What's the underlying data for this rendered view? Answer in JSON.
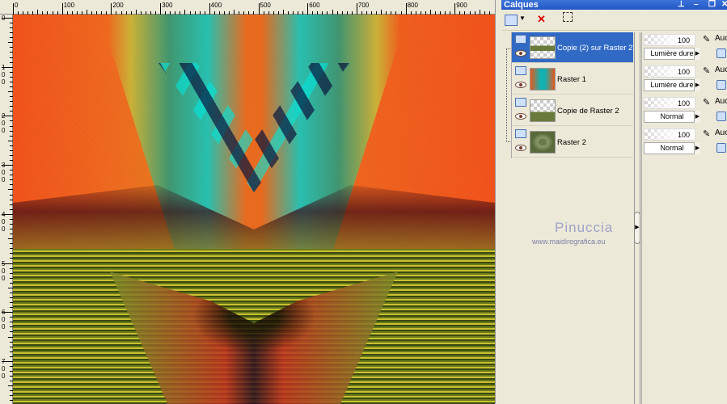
{
  "ruler": {
    "h_labels": [
      "0",
      "100",
      "200",
      "300",
      "400",
      "500",
      "600",
      "700",
      "800",
      "900"
    ],
    "v_labels": [
      "0",
      "1 0 0",
      "2 0 0",
      "3 0 0",
      "4 0 0",
      "5 0 0",
      "6 0 0",
      "7 0 0"
    ]
  },
  "palette": {
    "title": "Calques",
    "controls": [
      "pin-icon",
      "minimize-icon",
      "restore-icon",
      "close-icon"
    ]
  },
  "toolbar": {
    "buttons": [
      "new-layer-icon",
      "delete-layer-icon",
      "edit-selection-icon"
    ]
  },
  "layers": [
    {
      "name": "Copie (2) sur Raster 2",
      "selected": true,
      "opacity": "100",
      "blend": "Lumière dure",
      "extra": "Auc"
    },
    {
      "name": "Raster 1",
      "selected": false,
      "opacity": "100",
      "blend": "Lumière dure",
      "extra": "Auc"
    },
    {
      "name": "Copie de Raster 2",
      "selected": false,
      "opacity": "100",
      "blend": "Normal",
      "extra": "Auc"
    },
    {
      "name": "Raster 2",
      "selected": false,
      "opacity": "100",
      "blend": "Normal",
      "extra": "Auc"
    }
  ],
  "watermark": {
    "name": "Pinuccia",
    "url": "www.maidiregrafica.eu"
  },
  "colors": {
    "selection": "#316ac5",
    "title_bar": "#2357c5"
  }
}
